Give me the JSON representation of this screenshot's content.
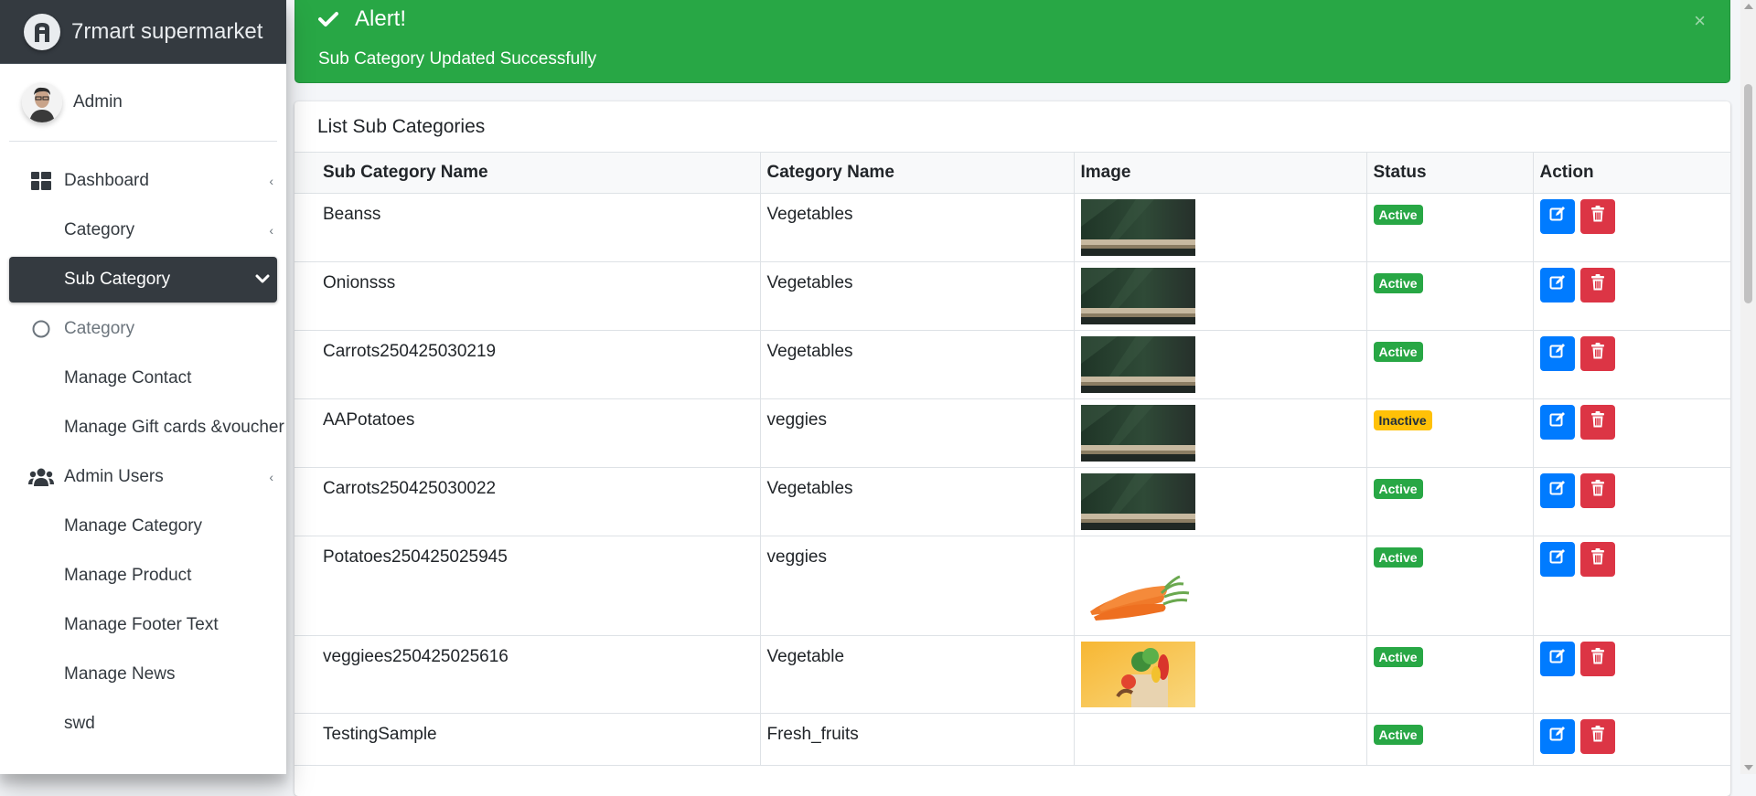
{
  "brand": {
    "name": "7rmart supermarket"
  },
  "user": {
    "name": "Admin"
  },
  "sidebar": {
    "items": [
      {
        "label": "Dashboard",
        "icon": "dashboard-icon",
        "type": "top",
        "caret": "‹"
      },
      {
        "label": "Category",
        "type": "sub",
        "caret": "‹"
      },
      {
        "label": "Sub Category",
        "type": "sub",
        "active": true,
        "caret": "chevron-down"
      },
      {
        "label": "Category",
        "icon": "circle-icon",
        "type": "top",
        "muted": true
      },
      {
        "label": "Manage Contact",
        "type": "sub"
      },
      {
        "label": "Manage Gift cards &voucher",
        "type": "sub"
      },
      {
        "label": "Admin Users",
        "icon": "users-icon",
        "type": "top",
        "caret": "‹"
      },
      {
        "label": "Manage Category",
        "type": "sub"
      },
      {
        "label": "Manage Product",
        "type": "sub"
      },
      {
        "label": "Manage Footer Text",
        "type": "sub"
      },
      {
        "label": "Manage News",
        "type": "sub"
      },
      {
        "label": "swd",
        "type": "sub"
      }
    ]
  },
  "alert": {
    "title": "Alert!",
    "message": "Sub Category Updated Successfully",
    "close": "×",
    "color": "#28a745"
  },
  "card": {
    "title": "List Sub Categories"
  },
  "table": {
    "headers": [
      "Sub Category Name",
      "Category Name",
      "Image",
      "Status",
      "Action"
    ],
    "rows": [
      {
        "sub": "Beanss",
        "cat": "Vegetables",
        "image": "shelf",
        "status": "Active"
      },
      {
        "sub": "Onionsss",
        "cat": "Vegetables",
        "image": "shelf",
        "status": "Active"
      },
      {
        "sub": "Carrots250425030219",
        "cat": "Vegetables",
        "image": "shelf",
        "status": "Active"
      },
      {
        "sub": "AAPotatoes",
        "cat": "veggies",
        "image": "shelf",
        "status": "Inactive"
      },
      {
        "sub": "Carrots250425030022",
        "cat": "Vegetables",
        "image": "shelf",
        "status": "Active"
      },
      {
        "sub": "Potatoes250425025945",
        "cat": "veggies",
        "image": "carrots",
        "status": "Active"
      },
      {
        "sub": "veggiees250425025616",
        "cat": "Vegetable",
        "image": "grocery-bag",
        "status": "Active"
      },
      {
        "sub": "TestingSample",
        "cat": "Fresh_fruits",
        "image": "none",
        "status": "Active"
      }
    ]
  },
  "colors": {
    "primary": "#007bff",
    "danger": "#dc3545",
    "success": "#28a745",
    "warning": "#ffc107",
    "dark": "#343a40"
  }
}
